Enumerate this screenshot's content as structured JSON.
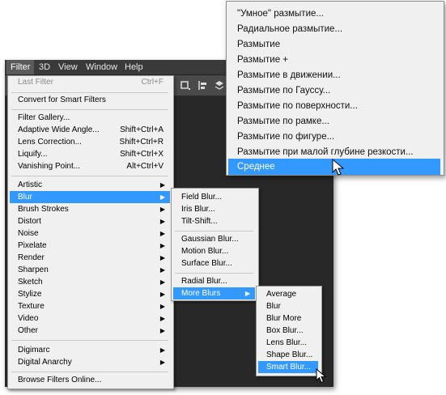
{
  "menubar": {
    "items": [
      "Filter",
      "3D",
      "View",
      "Window",
      "Help"
    ]
  },
  "filter_menu": {
    "last_filter": {
      "label": "Last Filter",
      "shortcut": "Ctrl+F"
    },
    "convert_smart": "Convert for Smart Filters",
    "group1": [
      {
        "label": "Filter Gallery...",
        "shortcut": ""
      },
      {
        "label": "Adaptive Wide Angle...",
        "shortcut": "Shift+Ctrl+A"
      },
      {
        "label": "Lens Correction...",
        "shortcut": "Shift+Ctrl+R"
      },
      {
        "label": "Liquify...",
        "shortcut": "Shift+Ctrl+X"
      },
      {
        "label": "Vanishing Point...",
        "shortcut": "Alt+Ctrl+V"
      }
    ],
    "submenus": [
      "Artistic",
      "Blur",
      "Brush Strokes",
      "Distort",
      "Noise",
      "Pixelate",
      "Render",
      "Sharpen",
      "Sketch",
      "Stylize",
      "Texture",
      "Video",
      "Other"
    ],
    "plugins": [
      "Digimarc",
      "Digital Anarchy"
    ],
    "browse_online": "Browse Filters Online..."
  },
  "blur_menu": {
    "group1": [
      "Field Blur...",
      "Iris Blur...",
      "Tilt-Shift..."
    ],
    "group2": [
      "Gaussian Blur...",
      "Motion Blur...",
      "Surface Blur..."
    ],
    "group3": [
      "Radial Blur...",
      "More Blurs"
    ]
  },
  "more_blurs_menu": {
    "items": [
      "Average",
      "Blur",
      "Blur More",
      "Box Blur...",
      "Lens Blur...",
      "Shape Blur...",
      "Smart Blur..."
    ]
  },
  "russian_menu": {
    "items": [
      "\"Умное\" размытие...",
      "Радиальное размытие...",
      "Размытие",
      "Размытие +",
      "Размытие в движении...",
      "Размытие по Гауссу...",
      "Размытие по поверхности...",
      "Размытие по рамке...",
      "Размытие по фигуре...",
      "Размытие при малой глубине резкости...",
      "Среднее"
    ],
    "selected_index": 10
  },
  "colors": {
    "highlight": "#3399ff",
    "menu_bg": "#f0f0f0",
    "app_dark": "#2b2b2b"
  }
}
